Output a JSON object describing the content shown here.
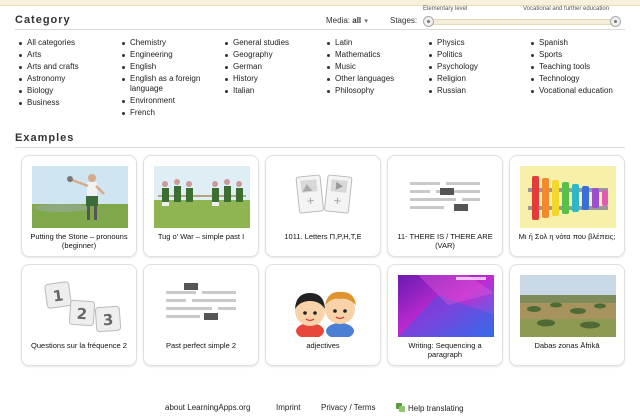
{
  "category": {
    "title": "Category",
    "media_label": "Media:",
    "media_value": "all",
    "stages_label": "Stages:",
    "stage_left": "Elementary level",
    "stage_right": "Vocational and further education",
    "columns": [
      [
        "All categories",
        "Arts",
        "Arts and crafts",
        "Astronomy",
        "Biology",
        "Business"
      ],
      [
        "Chemistry",
        "Engineering",
        "English",
        "English as a foreign language",
        "Environment",
        "French"
      ],
      [
        "General studies",
        "Geography",
        "German",
        "History",
        "Italian"
      ],
      [
        "Latin",
        "Mathematics",
        "Music",
        "Other languages",
        "Philosophy"
      ],
      [
        "Physics",
        "Politics",
        "Psychology",
        "Religion",
        "Russian"
      ],
      [
        "Spanish",
        "Sports",
        "Teaching tools",
        "Technology",
        "Vocational education"
      ]
    ]
  },
  "examples": {
    "title": "Examples",
    "cards": [
      {
        "label": "Putting the Stone – pronouns (beginner)",
        "thumb": "stone-thrower-image"
      },
      {
        "label": "Tug o' War – simple past I",
        "thumb": "tug-of-war-image"
      },
      {
        "label": "1011. Letters Π,Ρ,Η,Τ,Ε",
        "thumb": "image-video-cards-icon"
      },
      {
        "label": "11- THERE IS / THERE ARE (VAR)",
        "thumb": "text-gaps-icon"
      },
      {
        "label": "Μι ή Σολ η νότα που βλέπεις;",
        "thumb": "xylophone-image"
      },
      {
        "label": "Questions sur la fréquence 2",
        "thumb": "numbered-tiles-icon"
      },
      {
        "label": "Past perfect simple 2",
        "thumb": "text-gaps-icon"
      },
      {
        "label": "adjectives",
        "thumb": "children-cartoon-image"
      },
      {
        "label": "Writing: Sequencing a paragraph",
        "thumb": "purple-blue-abstract-image"
      },
      {
        "label": "Dabas zonas Āfrikā",
        "thumb": "savanna-landscape-image"
      }
    ]
  },
  "footer": {
    "about": "about LearningApps.org",
    "imprint": "Imprint",
    "privacy": "Privacy / Terms",
    "translate": "Help translating"
  }
}
